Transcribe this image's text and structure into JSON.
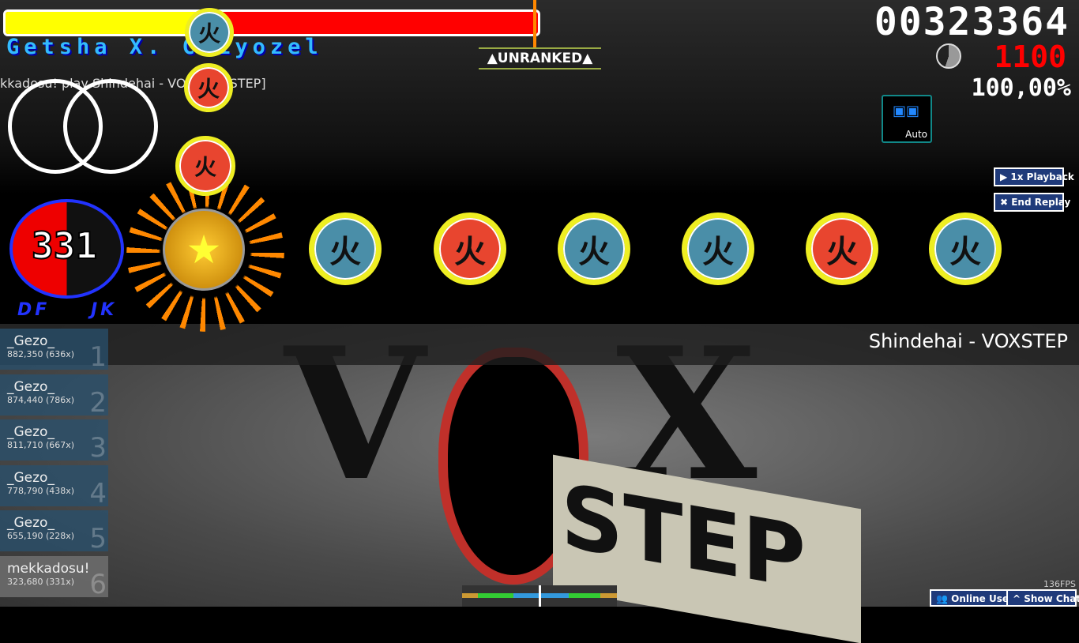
{
  "hud": {
    "artist": "Getsha X. Chiyozel",
    "play_text": "kkadosu! play Shindehai - VO... [ONISTEP]",
    "unranked": "▲UNRANKED▲",
    "score": "00323364",
    "combo_counter": "1100",
    "accuracy": "100,00%",
    "health_fraction": 0.37
  },
  "mod": {
    "icon": "auto-mod-icon",
    "label": "Auto"
  },
  "buttons": {
    "playback": "▶ 1x Playback",
    "end_replay": "✖ End Replay",
    "online_users": "Online Users",
    "show_chat": "^ Show Chat"
  },
  "taiko": {
    "combo": "331",
    "keys": "DF JK",
    "note_glyph": "火",
    "notes": [
      "blue",
      "red",
      "blue",
      "blue",
      "red",
      "blue"
    ]
  },
  "song_title": "Shindehai - VOXSTEP",
  "background": {
    "letters": [
      "V",
      "X"
    ],
    "sign": "STEP"
  },
  "leaderboard": [
    {
      "name": "_Gezo_",
      "score": "882,350 (636x)",
      "rank": "1"
    },
    {
      "name": "_Gezo_",
      "score": "874,440 (786x)",
      "rank": "2"
    },
    {
      "name": "_Gezo_",
      "score": "811,710 (667x)",
      "rank": "3"
    },
    {
      "name": "_Gezo_",
      "score": "778,790 (438x)",
      "rank": "4"
    },
    {
      "name": "_Gezo_",
      "score": "655,190 (228x)",
      "rank": "5"
    },
    {
      "name": "mekkadosu!",
      "score": "323,680 (331x)",
      "rank": "6"
    }
  ],
  "fps": "136FPS",
  "colors": {
    "health": "#ffff00",
    "health_bg": "#ff0000",
    "red_note": "#e8452f",
    "blue_note": "#4a8ea8"
  }
}
